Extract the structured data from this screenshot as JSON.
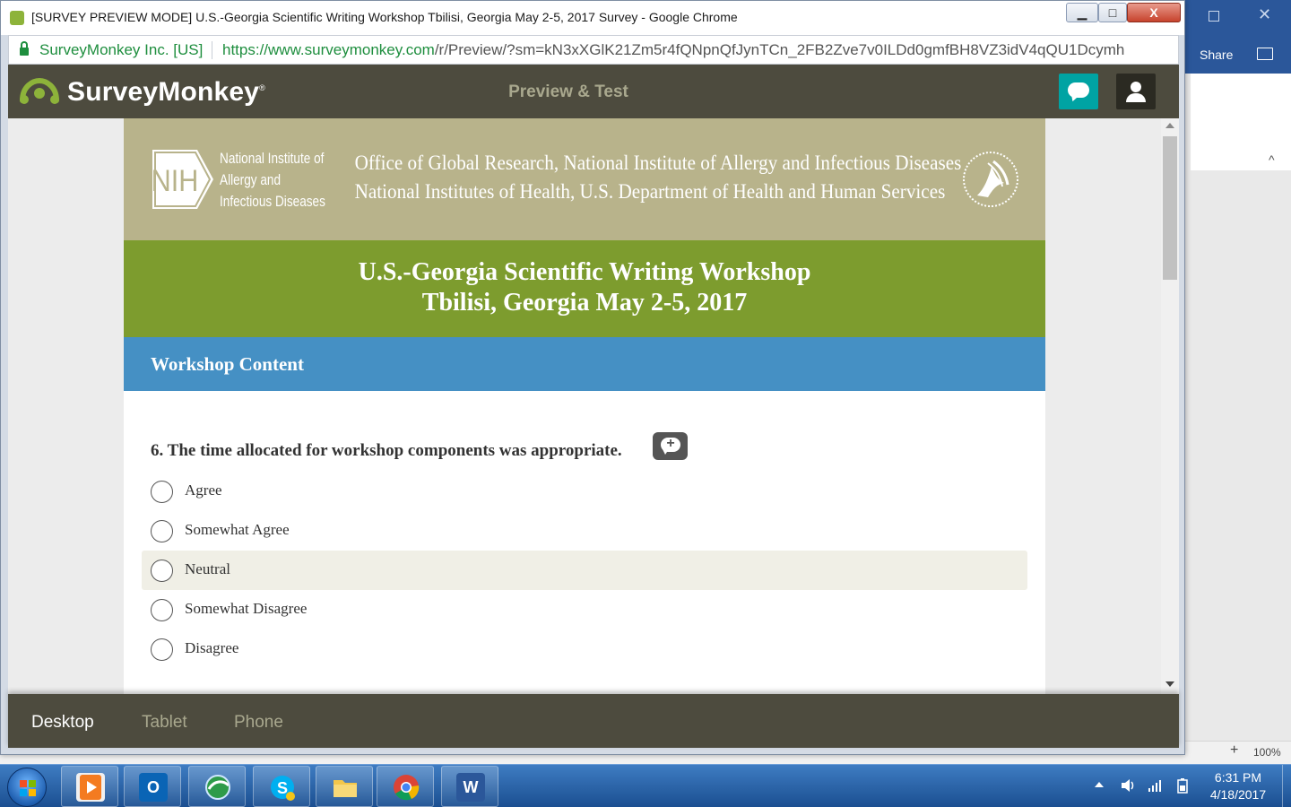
{
  "browser": {
    "window_title": "[SURVEY PREVIEW MODE] U.S.-Georgia Scientific Writing Workshop Tbilisi, Georgia May 2-5, 2017 Survey - Google Chrome",
    "site_identity": "SurveyMonkey Inc. [US]",
    "url_origin": "https://www.surveymonkey.com",
    "url_path": "/r/Preview/?sm=kN3xXGlK21Zm5r4fQNpnQfJynTCn_2FB2Zve7v0ILDd0gmfBH8VZ3idV4qQU1Dcymh",
    "minimize_glyph": "▁",
    "maximize_glyph": "□",
    "close_glyph": "X"
  },
  "surveymonkey": {
    "logo_text": "SurveyMonkey",
    "logo_mark": "®",
    "mode_title": "Preview & Test"
  },
  "survey": {
    "nih_logo_text": "NIH",
    "nih_name_lines": [
      "National Institute of",
      "Allergy and",
      "Infectious Diseases"
    ],
    "office_lines": [
      "Office of Global Research, National Institute of Allergy and Infectious Diseases",
      "National Institutes of Health, U.S. Department of Health and Human Services"
    ],
    "title_lines": [
      "U.S.-Georgia Scientific Writing Workshop",
      "Tbilisi, Georgia May 2-5, 2017"
    ],
    "page_title": "Workshop Content",
    "question": "6. The time allocated for workshop components was appropriate.",
    "comment_plus": "+",
    "options": [
      "Agree",
      "Somewhat Agree",
      "Neutral",
      "Somewhat Disagree",
      "Disagree"
    ],
    "hovered_option": "Neutral"
  },
  "device_bar": {
    "desktop": "Desktop",
    "tablet": "Tablet",
    "phone": "Phone",
    "active": "Desktop"
  },
  "word_window": {
    "share": "Share",
    "zoom": "100%",
    "close_glyph": "✕",
    "plus": "+",
    "collapse_glyph": "^"
  },
  "taskbar": {
    "outlook_letter": "O",
    "word_letter": "W",
    "time": "6:31 PM",
    "date": "4/18/2017"
  },
  "colors": {
    "sm_header": "#4d4b3e",
    "nih_band": "#b8b38b",
    "title_band": "#7d9c2e",
    "page_band": "#4590c4",
    "sm_chat_accent": "#00a3a3",
    "url_green": "#1e8e3e"
  }
}
